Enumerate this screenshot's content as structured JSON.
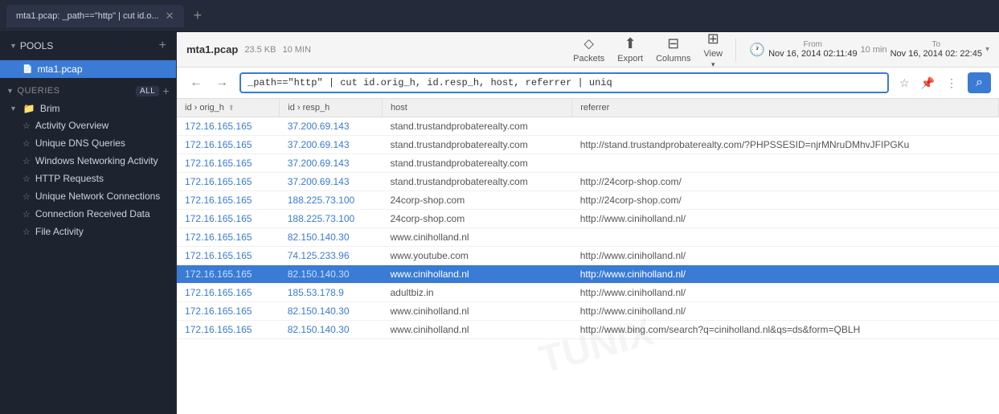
{
  "tab": {
    "title": "mta1.pcap: _path==\"http\" | cut id.o...",
    "close_icon": "✕"
  },
  "sidebar": {
    "pools_label": "POOLS",
    "add_icon": "+",
    "pool_item": "mta1.pcap",
    "queries_label": "QUERIES",
    "all_label": "All",
    "folder_label": "Brim",
    "queries": [
      {
        "label": "Activity Overview"
      },
      {
        "label": "Unique DNS Queries"
      },
      {
        "label": "Windows Networking Activity"
      },
      {
        "label": "HTTP Requests"
      },
      {
        "label": "Unique Network Connections"
      },
      {
        "label": "Connection Received Data"
      },
      {
        "label": "File Activity"
      }
    ]
  },
  "toolbar": {
    "filename": "mta1.pcap",
    "filesize": "23.5 KB",
    "duration": "10 MIN",
    "packets_label": "Packets",
    "export_label": "Export",
    "columns_label": "Columns",
    "view_label": "View",
    "from_label": "From",
    "from_value": "Nov 16, 2014  02:11:49",
    "to_label": "To",
    "to_value": "Nov 16, 2014  02: 22:45",
    "duration_badge": "10 min"
  },
  "search": {
    "query": "_path==\"http\" | cut id.orig_h, id.resp_h, host, referrer | uniq",
    "back_icon": "←",
    "forward_icon": "→",
    "star_icon": "☆",
    "pin_icon": "📌",
    "more_icon": "⋮",
    "go_icon": "⌕"
  },
  "table": {
    "columns": [
      {
        "label": "id › orig_h"
      },
      {
        "label": "id › resp_h"
      },
      {
        "label": "host"
      },
      {
        "label": "referrer"
      }
    ],
    "rows": [
      {
        "orig_h": "172.16.165.165",
        "resp_h": "37.200.69.143",
        "host": "stand.trustandprobaterealty.com",
        "referrer": "",
        "selected": false
      },
      {
        "orig_h": "172.16.165.165",
        "resp_h": "37.200.69.143",
        "host": "stand.trustandprobaterealty.com",
        "referrer": "http://stand.trustandprobaterealty.com/?PHPSSESID=njrMNruDMhvJFIPGKu",
        "selected": false
      },
      {
        "orig_h": "172.16.165.165",
        "resp_h": "37.200.69.143",
        "host": "stand.trustandprobaterealty.com",
        "referrer": "",
        "selected": false
      },
      {
        "orig_h": "172.16.165.165",
        "resp_h": "37.200.69.143",
        "host": "stand.trustandprobaterealty.com",
        "referrer": "http://24corp-shop.com/",
        "selected": false
      },
      {
        "orig_h": "172.16.165.165",
        "resp_h": "188.225.73.100",
        "host": "24corp-shop.com",
        "referrer": "http://24corp-shop.com/",
        "selected": false
      },
      {
        "orig_h": "172.16.165.165",
        "resp_h": "188.225.73.100",
        "host": "24corp-shop.com",
        "referrer": "http://www.ciniholland.nl/",
        "selected": false
      },
      {
        "orig_h": "172.16.165.165",
        "resp_h": "82.150.140.30",
        "host": "www.ciniholland.nl",
        "referrer": "",
        "selected": false
      },
      {
        "orig_h": "172.16.165.165",
        "resp_h": "74.125.233.96",
        "host": "www.youtube.com",
        "referrer": "http://www.ciniholland.nl/",
        "selected": false
      },
      {
        "orig_h": "172.16.165.165",
        "resp_h": "82.150.140.30",
        "host": "www.ciniholland.nl",
        "referrer": "http://www.ciniholland.nl/",
        "selected": true
      },
      {
        "orig_h": "172.16.165.165",
        "resp_h": "185.53.178.9",
        "host": "adultbiz.in",
        "referrer": "http://www.ciniholland.nl/",
        "selected": false
      },
      {
        "orig_h": "172.16.165.165",
        "resp_h": "82.150.140.30",
        "host": "www.ciniholland.nl",
        "referrer": "http://www.ciniholland.nl/",
        "selected": false
      },
      {
        "orig_h": "172.16.165.165",
        "resp_h": "82.150.140.30",
        "host": "www.ciniholland.nl",
        "referrer": "http://www.bing.com/search?q=ciniholland.nl&qs=ds&form=QBLH",
        "selected": false
      }
    ]
  },
  "watermark": "TUNIX"
}
